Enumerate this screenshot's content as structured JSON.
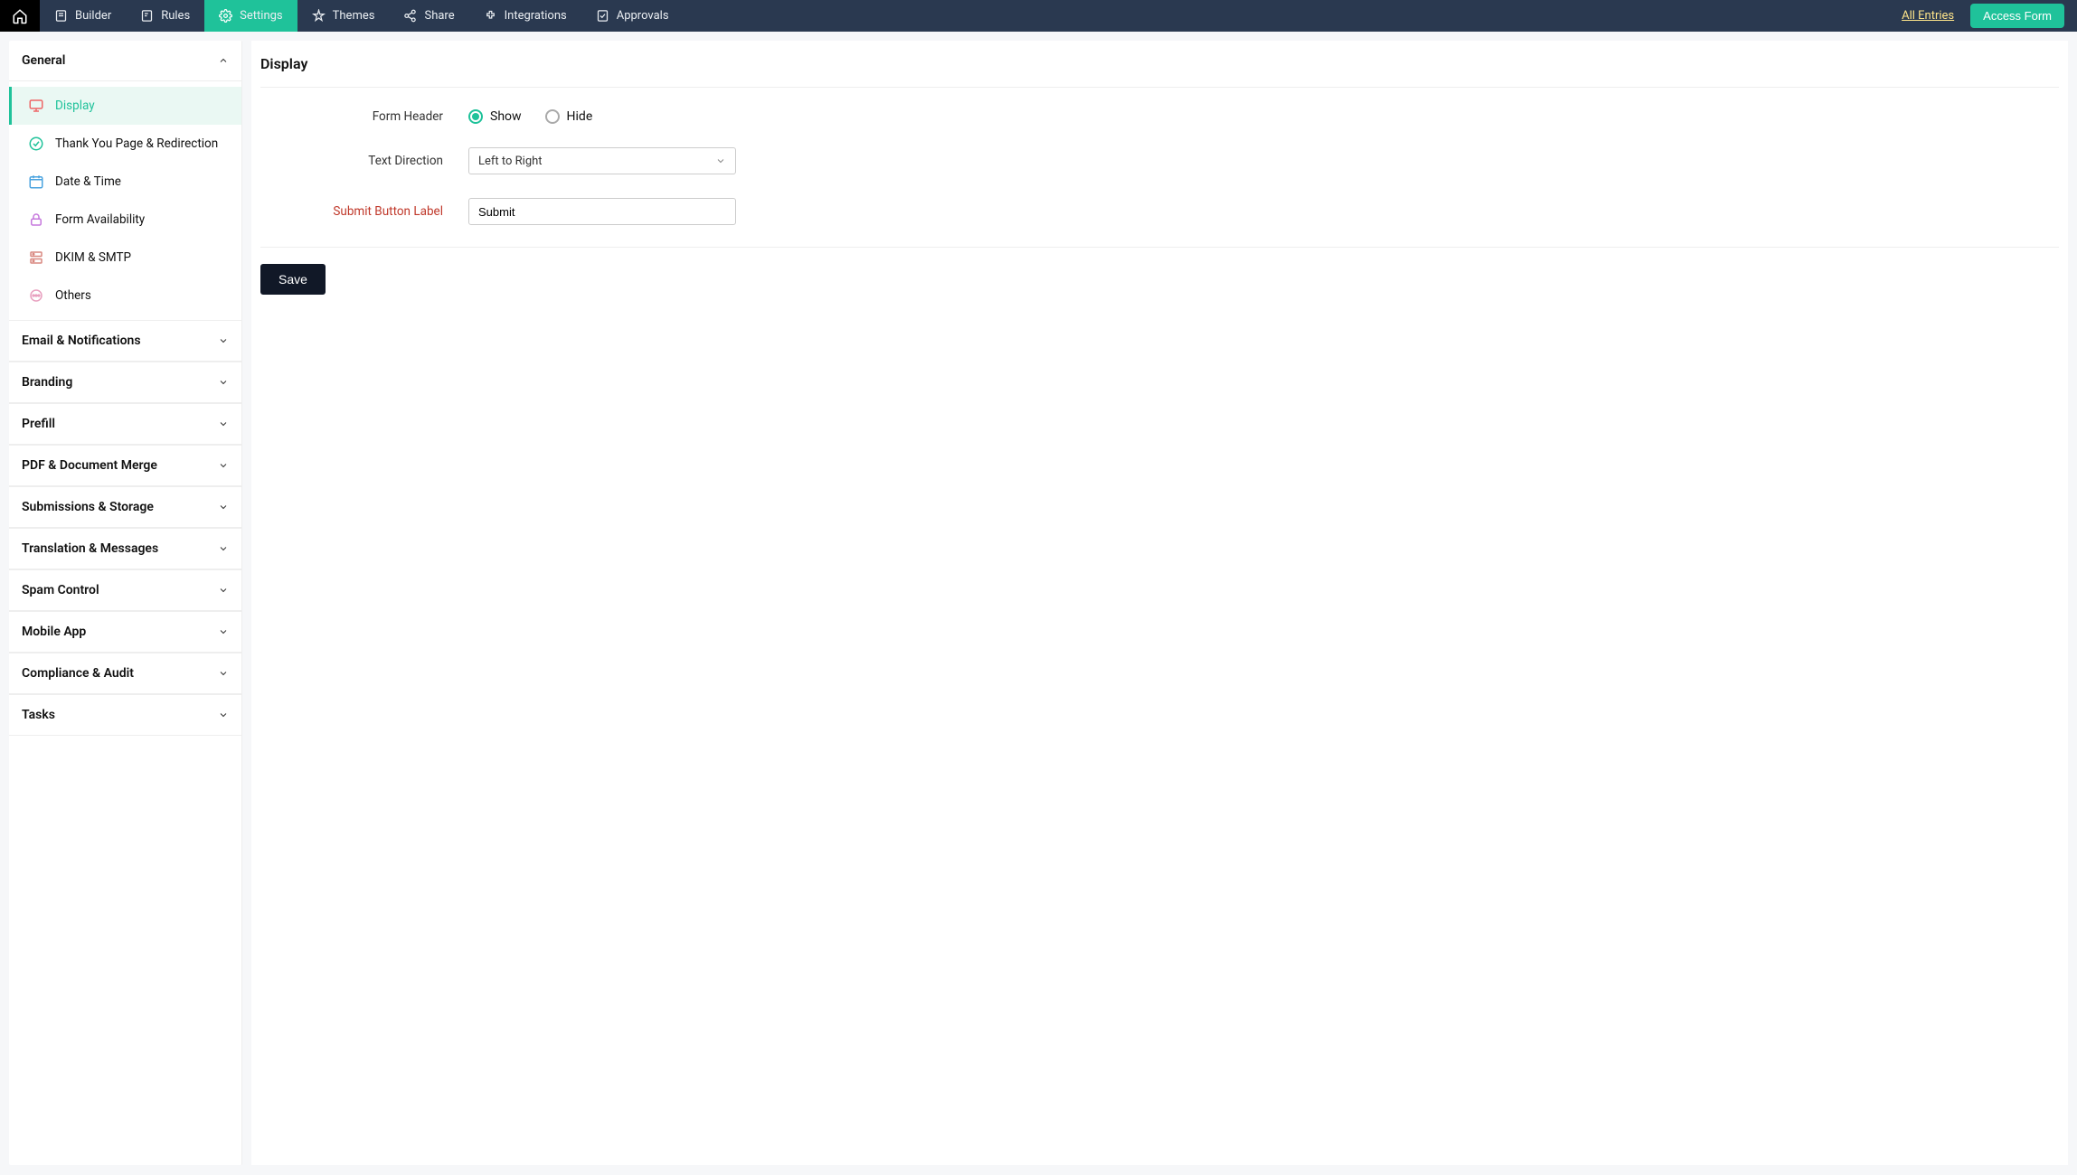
{
  "topnav": {
    "items": [
      {
        "label": "Builder",
        "icon": "builder"
      },
      {
        "label": "Rules",
        "icon": "rules"
      },
      {
        "label": "Settings",
        "icon": "settings",
        "active": true
      },
      {
        "label": "Themes",
        "icon": "themes"
      },
      {
        "label": "Share",
        "icon": "share"
      },
      {
        "label": "Integrations",
        "icon": "integrations"
      },
      {
        "label": "Approvals",
        "icon": "approvals"
      }
    ],
    "all_entries": "All Entries",
    "access_form": "Access Form"
  },
  "sidebar": {
    "groups": [
      {
        "label": "General",
        "expanded": true,
        "items": [
          {
            "label": "Display",
            "icon": "monitor",
            "active": true
          },
          {
            "label": "Thank You Page & Redirection",
            "icon": "check-circle"
          },
          {
            "label": "Date & Time",
            "icon": "calendar"
          },
          {
            "label": "Form Availability",
            "icon": "lock"
          },
          {
            "label": "DKIM & SMTP",
            "icon": "server"
          },
          {
            "label": "Others",
            "icon": "dots"
          }
        ]
      },
      {
        "label": "Email & Notifications",
        "expanded": false
      },
      {
        "label": "Branding",
        "expanded": false
      },
      {
        "label": "Prefill",
        "expanded": false
      },
      {
        "label": "PDF & Document Merge",
        "expanded": false
      },
      {
        "label": "Submissions & Storage",
        "expanded": false
      },
      {
        "label": "Translation & Messages",
        "expanded": false
      },
      {
        "label": "Spam Control",
        "expanded": false
      },
      {
        "label": "Mobile App",
        "expanded": false
      },
      {
        "label": "Compliance & Audit",
        "expanded": false
      },
      {
        "label": "Tasks",
        "expanded": false
      }
    ]
  },
  "page": {
    "title": "Display",
    "form_header_label": "Form Header",
    "show_label": "Show",
    "hide_label": "Hide",
    "form_header_value": "show",
    "text_direction_label": "Text Direction",
    "text_direction_value": "Left to Right",
    "submit_button_label_label": "Submit Button Label",
    "submit_button_label_value": "Submit",
    "save_label": "Save"
  }
}
